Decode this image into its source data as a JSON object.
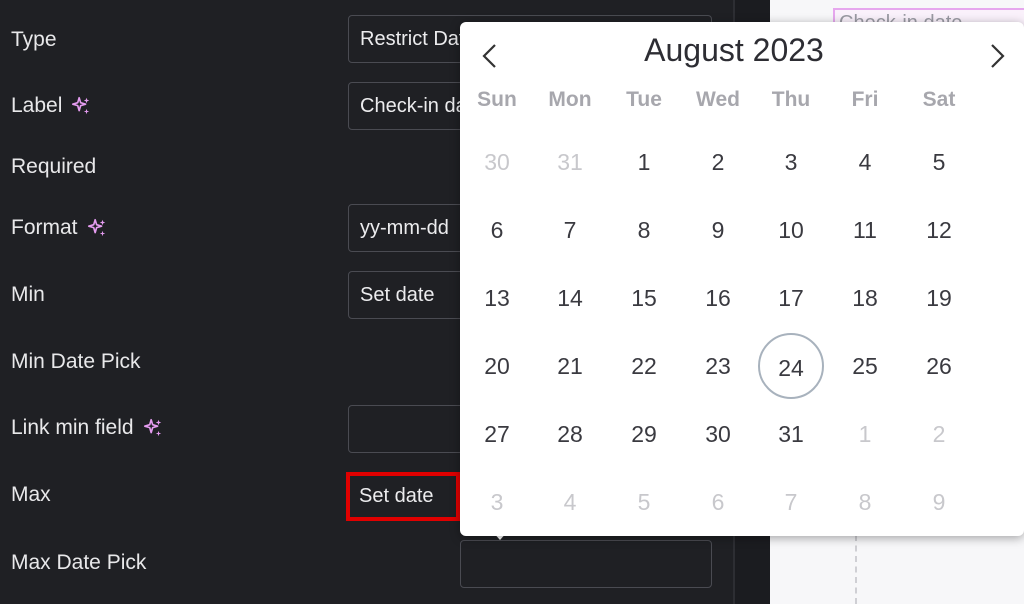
{
  "form": {
    "type": {
      "label": "Type",
      "value": "Restrict Date"
    },
    "label": {
      "label": "Label",
      "value": "Check-in date"
    },
    "required": {
      "label": "Required"
    },
    "format": {
      "label": "Format",
      "value": "yy-mm-dd"
    },
    "min": {
      "label": "Min",
      "value": "Set date"
    },
    "min_date_pick": {
      "label": "Min Date Pick"
    },
    "link_min_field": {
      "label": "Link min field",
      "value": ""
    },
    "max": {
      "label": "Max",
      "value": "Set date"
    },
    "max_date_pick": {
      "label": "Max Date Pick",
      "value": ""
    }
  },
  "canvas": {
    "field_text": "Check-in date"
  },
  "datepicker": {
    "title": "August 2023",
    "weekdays": [
      "Sun",
      "Mon",
      "Tue",
      "Wed",
      "Thu",
      "Fri",
      "Sat"
    ],
    "weeks": [
      [
        {
          "d": "30",
          "m": true
        },
        {
          "d": "31",
          "m": true
        },
        {
          "d": "1"
        },
        {
          "d": "2"
        },
        {
          "d": "3"
        },
        {
          "d": "4"
        },
        {
          "d": "5"
        }
      ],
      [
        {
          "d": "6"
        },
        {
          "d": "7"
        },
        {
          "d": "8"
        },
        {
          "d": "9"
        },
        {
          "d": "10"
        },
        {
          "d": "11"
        },
        {
          "d": "12"
        }
      ],
      [
        {
          "d": "13"
        },
        {
          "d": "14"
        },
        {
          "d": "15"
        },
        {
          "d": "16"
        },
        {
          "d": "17"
        },
        {
          "d": "18"
        },
        {
          "d": "19"
        }
      ],
      [
        {
          "d": "20"
        },
        {
          "d": "21"
        },
        {
          "d": "22"
        },
        {
          "d": "23"
        },
        {
          "d": "24",
          "today": true
        },
        {
          "d": "25"
        },
        {
          "d": "26"
        }
      ],
      [
        {
          "d": "27"
        },
        {
          "d": "28"
        },
        {
          "d": "29"
        },
        {
          "d": "30"
        },
        {
          "d": "31"
        },
        {
          "d": "1",
          "m": true
        },
        {
          "d": "2",
          "m": true
        }
      ],
      [
        {
          "d": "3",
          "m": true
        },
        {
          "d": "4",
          "m": true
        },
        {
          "d": "5",
          "m": true
        },
        {
          "d": "6",
          "m": true
        },
        {
          "d": "7",
          "m": true
        },
        {
          "d": "8",
          "m": true
        },
        {
          "d": "9",
          "m": true
        }
      ]
    ]
  },
  "colors": {
    "panel_bg": "#1f2024",
    "sparkle": "#e59cf0",
    "highlight": "#e00000",
    "today_ring": "#a8b2bd"
  },
  "icons": {
    "sparkle": "sparkle-icon",
    "prev": "chevron-left-icon",
    "next": "chevron-right-icon"
  }
}
